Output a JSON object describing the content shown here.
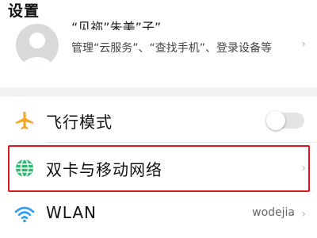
{
  "header": {
    "title": "设置"
  },
  "account": {
    "name": "“见祢”朱美”子”",
    "description": "管理“云服务”、“查找手机”、登录设备等"
  },
  "settings": {
    "airplane": {
      "label": "飞行模式",
      "toggle_on": false
    },
    "dual_sim": {
      "label": "双卡与移动网络"
    },
    "wlan": {
      "label": "WLAN",
      "value": "wodejia"
    }
  },
  "icons": {
    "airplane": "airplane-icon",
    "network": "globe-icon",
    "wlan": "wifi-icon",
    "chevron": "chevron-right-icon"
  },
  "colors": {
    "airplane_icon": "#f5a623",
    "network_icon": "#2fb870",
    "wifi_icon": "#2a9df4",
    "highlight": "#e0151b"
  },
  "glyphs": {
    "chevron": "›"
  }
}
